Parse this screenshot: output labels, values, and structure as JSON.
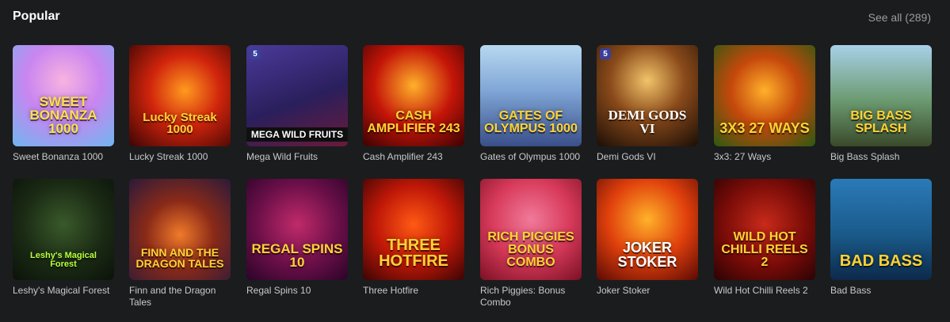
{
  "header": {
    "title": "Popular",
    "see_all": "See all (289)"
  },
  "rows": [
    [
      {
        "name": "Sweet Bonanza 1000",
        "logo": "SWEET BONANZA 1000"
      },
      {
        "name": "Lucky Streak 1000",
        "logo": "Lucky Streak 1000"
      },
      {
        "name": "Mega Wild Fruits",
        "logo": "MEGA WILD FRUITS"
      },
      {
        "name": "Cash Amplifier 243",
        "logo": "CASH AMPLIFIER 243"
      },
      {
        "name": "Gates of Olympus 1000",
        "logo": "Gates of OLYMPUS 1000"
      },
      {
        "name": "Demi Gods VI",
        "logo": "DEMI GODS VI"
      },
      {
        "name": "3x3: 27 Ways",
        "logo": "3X3 27 WAYS"
      },
      {
        "name": "Big Bass Splash",
        "logo": "BIG BASS SPLASH"
      }
    ],
    [
      {
        "name": "Leshy's Magical Forest",
        "logo": "Leshy's Magical Forest"
      },
      {
        "name": "Finn and the Dragon Tales",
        "logo": "FINN AND THE DRAGON TALES"
      },
      {
        "name": "Regal Spins 10",
        "logo": "REGAL SPINS 10"
      },
      {
        "name": "Three Hotfire",
        "logo": "THREE HOTFIRE"
      },
      {
        "name": "Rich Piggies: Bonus Combo",
        "logo": "RICH PIGGIES BONUS COMBO"
      },
      {
        "name": "Joker Stoker",
        "logo": "JOKER STOKER"
      },
      {
        "name": "Wild Hot Chilli Reels 2",
        "logo": "WILD HOT Chilli Reels 2"
      },
      {
        "name": "Bad Bass",
        "logo": "BAD BASS"
      }
    ]
  ]
}
